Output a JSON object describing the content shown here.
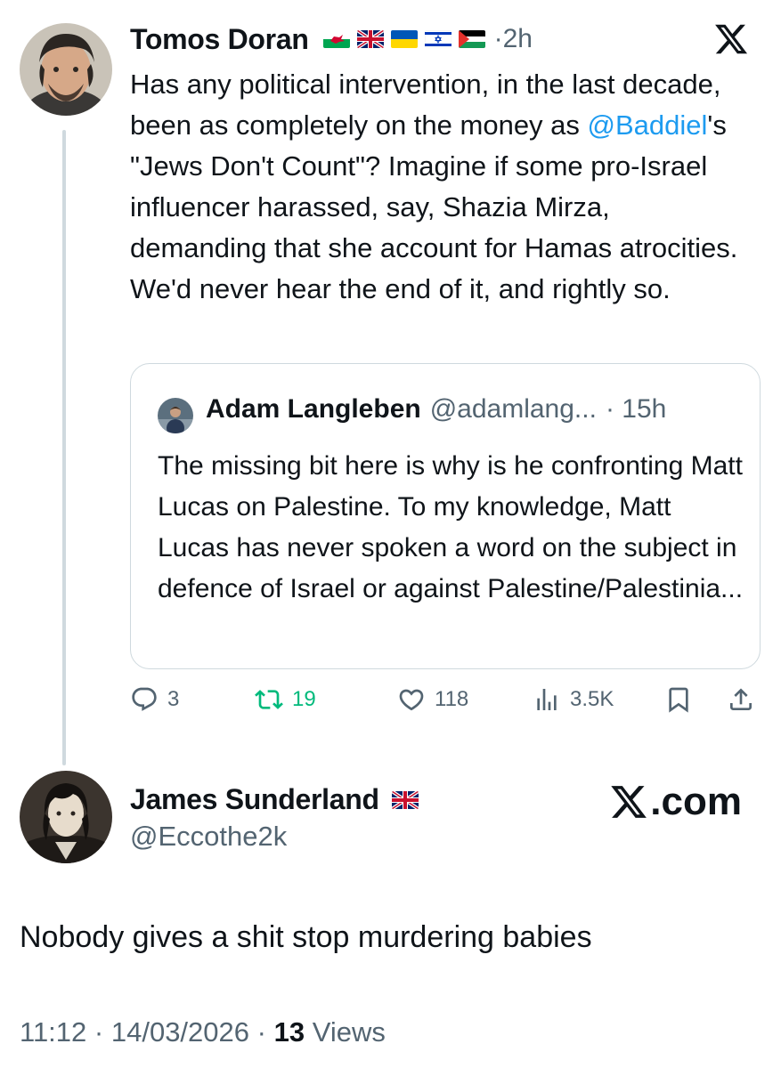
{
  "tweet1": {
    "display_name": "Tomos Doran",
    "flags": [
      "wales-flag",
      "uk-flag",
      "ukraine-flag",
      "israel-flag",
      "palestine-flag"
    ],
    "time_sep": "·",
    "time": "2h",
    "body_part1": "Has any political intervention, in the last decade, been as completely on the money as ",
    "mention": "@Baddiel",
    "body_part2": "'s \"Jews Don't Count\"? Imagine if some pro-Israel influencer harassed, say, Shazia Mirza, demanding that she account for Hamas atrocities. We'd never hear the end of it, and rightly so."
  },
  "quoted_tweet": {
    "display_name": "Adam Langleben",
    "handle": "@adamlang...",
    "time": "· 15h",
    "body": "The missing bit here is why is he confronting Matt Lucas on Palestine. To my knowledge, Matt Lucas has never spoken a word on the subject in defence of Israel or against Palestine/Palestinia..."
  },
  "actions": {
    "replies": "3",
    "retweets": "19",
    "likes": "118",
    "views": "3.5K"
  },
  "tweet2": {
    "display_name": "James Sunderland",
    "flags": [
      "uk-flag"
    ],
    "handle": "@Eccothe2k",
    "watermark": ".com",
    "body": "Nobody gives a shit stop murdering babies"
  },
  "meta": {
    "time": "11:12",
    "date": "14/03/2026",
    "views_count": "13",
    "views_label": "Views",
    "sep": "·"
  },
  "colors": {
    "link": "#1d9bf0",
    "muted": "#536471",
    "retweet": "#00ba7c",
    "border": "#cfd9de"
  }
}
